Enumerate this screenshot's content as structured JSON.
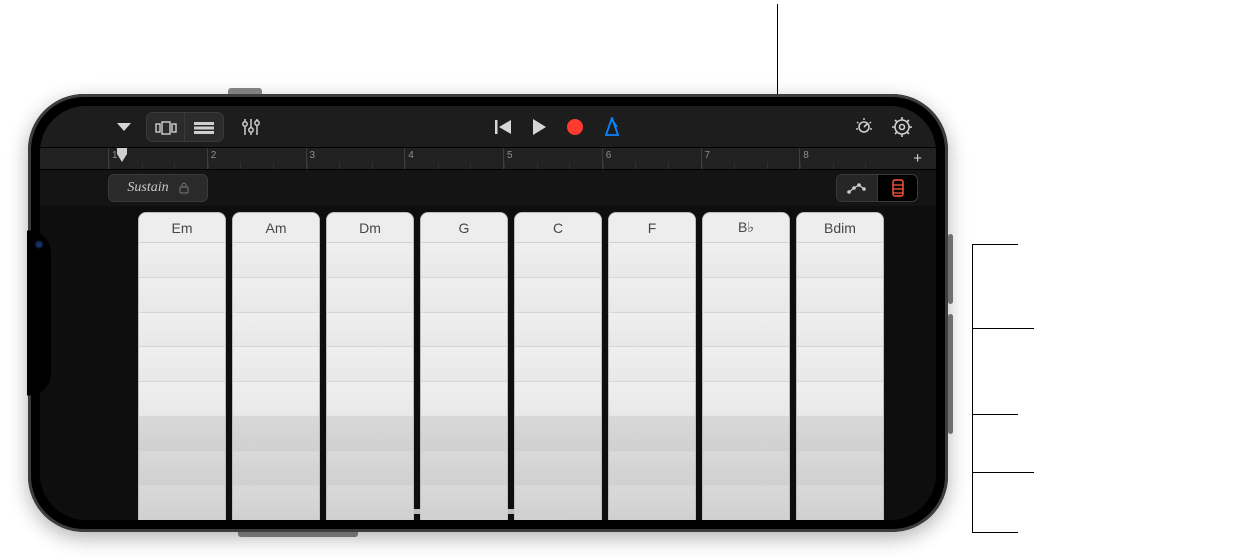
{
  "toolbar": {
    "chevron_button": "menu",
    "view_a": "browser",
    "view_b": "tracks",
    "mixer": "mixer",
    "prev": "previous",
    "play": "play",
    "record": "record",
    "metronome": "metronome",
    "sound": "sound-browser",
    "settings": "settings"
  },
  "ruler": {
    "bars": [
      "1",
      "2",
      "3",
      "4",
      "5",
      "6",
      "7",
      "8"
    ],
    "add": "+"
  },
  "sustain": {
    "label": "Sustain"
  },
  "modes": {
    "arpeggiator": "arpeggiator",
    "chord_strips": "chord-strips"
  },
  "chords": [
    "Em",
    "Am",
    "Dm",
    "G",
    "C",
    "F",
    "B♭",
    "Bdim"
  ],
  "segments_light": 5,
  "segments_dark": 3,
  "colors": {
    "record": "#ff3b30",
    "metronome": "#0a84ff",
    "mode_active": "#ff5a3c"
  }
}
